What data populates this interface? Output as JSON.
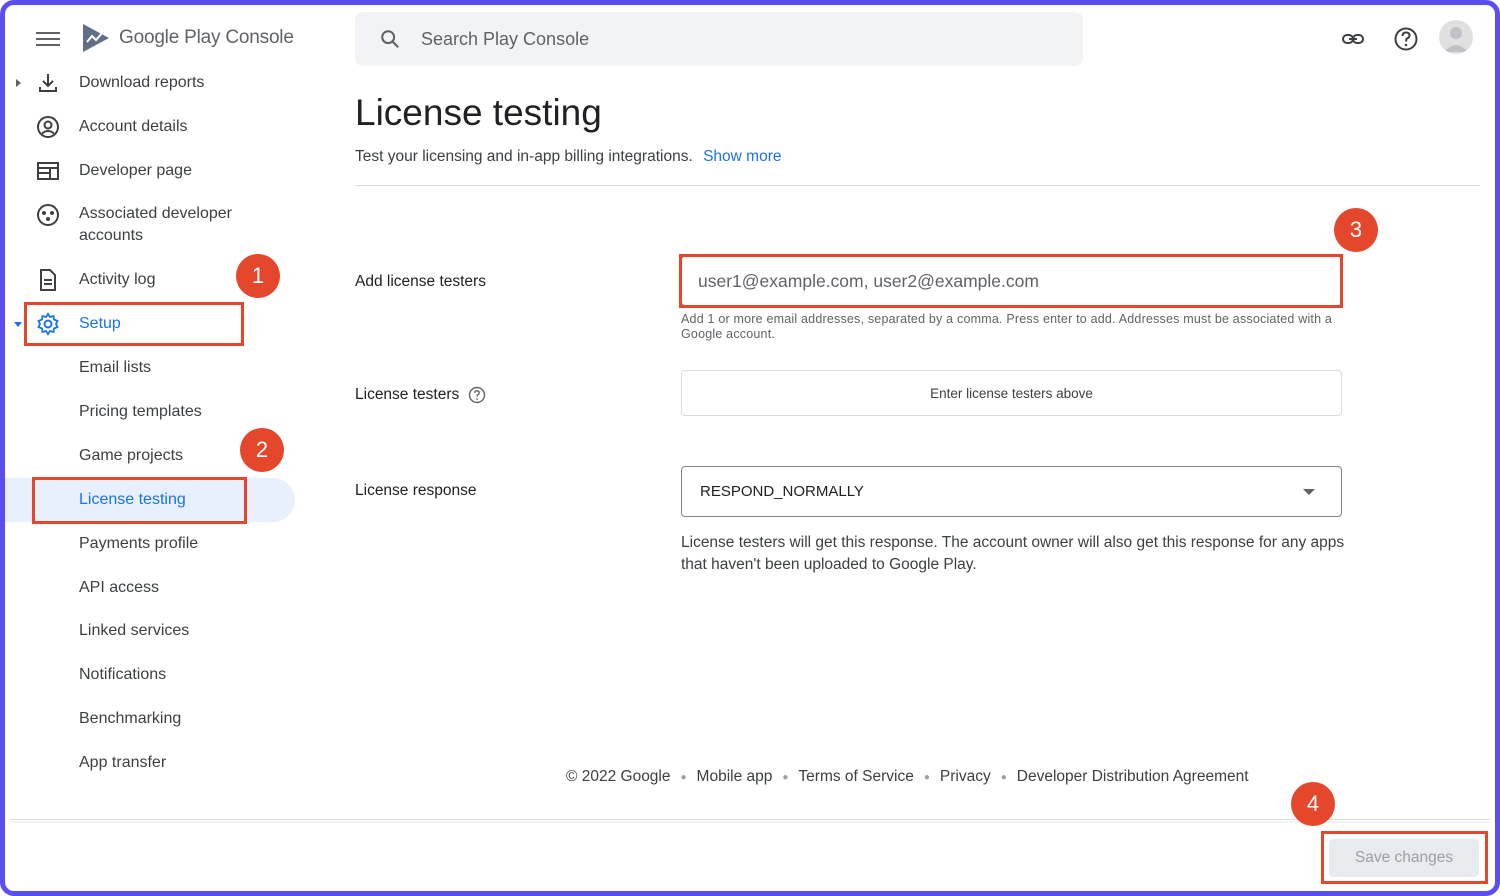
{
  "header": {
    "app_name": "Google Play Console",
    "search_placeholder": "Search Play Console"
  },
  "sidebar": {
    "items": [
      {
        "label": "Download reports"
      },
      {
        "label": "Account details"
      },
      {
        "label": "Developer page"
      },
      {
        "label": "Associated developer accounts"
      },
      {
        "label": "Activity log"
      },
      {
        "label": "Setup"
      },
      {
        "label": "Email lists"
      },
      {
        "label": "Pricing templates"
      },
      {
        "label": "Game projects"
      },
      {
        "label": "License testing"
      },
      {
        "label": "Payments profile"
      },
      {
        "label": "API access"
      },
      {
        "label": "Linked services"
      },
      {
        "label": "Notifications"
      },
      {
        "label": "Benchmarking"
      },
      {
        "label": "App transfer"
      }
    ]
  },
  "main": {
    "title": "License testing",
    "subtitle": "Test your licensing and in-app billing integrations.",
    "show_more": "Show more",
    "add_testers_label": "Add license testers",
    "add_testers_placeholder": "user1@example.com, user2@example.com",
    "add_testers_hint": "Add 1 or more email addresses, separated by a comma. Press enter to add. Addresses must be associated with a Google account.",
    "testers_label": "License testers",
    "testers_empty": "Enter license testers above",
    "response_label": "License response",
    "response_value": "RESPOND_NORMALLY",
    "response_help": "License testers will get this response. The account owner will also get this response for any apps that haven't been uploaded to Google Play."
  },
  "footer": {
    "copyright": "© 2022 Google",
    "links": [
      "Mobile app",
      "Terms of Service",
      "Privacy",
      "Developer Distribution Agreement"
    ]
  },
  "actions": {
    "save_label": "Save changes"
  },
  "annotations": {
    "badges": [
      "1",
      "2",
      "3",
      "4"
    ],
    "color": "#e5472c"
  },
  "colors": {
    "accent": "#1a73e8",
    "frame": "#5b4ef0",
    "selected_bg": "#e8f0fe"
  }
}
